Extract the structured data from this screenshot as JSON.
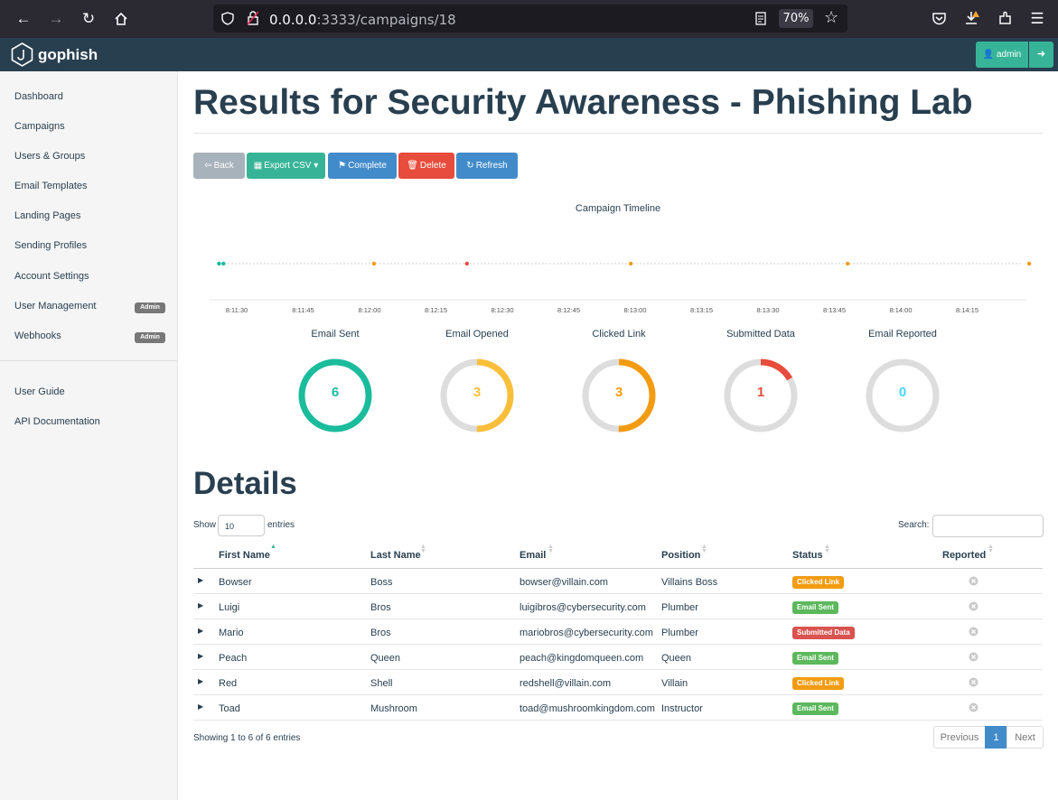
{
  "browser": {
    "url_host": "0.0.0.0",
    "url_rest": ":3333/campaigns/18",
    "zoom": "70%"
  },
  "navbar": {
    "brand": "gophish",
    "user_label": "admin"
  },
  "sidebar": {
    "items": [
      {
        "label": "Dashboard"
      },
      {
        "label": "Campaigns"
      },
      {
        "label": "Users & Groups"
      },
      {
        "label": "Email Templates"
      },
      {
        "label": "Landing Pages"
      },
      {
        "label": "Sending Profiles"
      },
      {
        "label": "Account Settings"
      },
      {
        "label": "User Management",
        "badge": "Admin"
      },
      {
        "label": "Webhooks",
        "badge": "Admin"
      }
    ],
    "secondary_items": [
      {
        "label": "User Guide"
      },
      {
        "label": "API Documentation"
      }
    ]
  },
  "page": {
    "title": "Results for Security Awareness - Phishing Lab",
    "buttons": {
      "back": "Back",
      "export": "Export CSV",
      "complete": "Complete",
      "delete": "Delete",
      "refresh": "Refresh"
    }
  },
  "timeline": {
    "title": "Campaign Timeline",
    "ticks": [
      "8:11:30",
      "8:11:45",
      "8:12:00",
      "8:12:15",
      "8:12:30",
      "8:12:45",
      "8:13:00",
      "8:13:15",
      "8:13:30",
      "8:13:45",
      "8:14:00",
      "8:14:15"
    ],
    "events": [
      {
        "time": "8:11:26",
        "type": "Email Sent",
        "color": "#1abc9c"
      },
      {
        "time": "8:11:27",
        "type": "Email Sent",
        "color": "#1abc9c"
      },
      {
        "time": "8:12:01",
        "type": "Email Opened",
        "color": "#f39c12"
      },
      {
        "time": "8:12:22",
        "type": "Submitted Data",
        "color": "#e74c3c"
      },
      {
        "time": "8:12:59",
        "type": "Email Opened",
        "color": "#f39c12"
      },
      {
        "time": "8:13:48",
        "type": "Clicked Link",
        "color": "#f39c12"
      },
      {
        "time": "8:14:29",
        "type": "Clicked Link",
        "color": "#f39c12"
      }
    ]
  },
  "stats": [
    {
      "label": "Email Sent",
      "value": "6",
      "total": 6,
      "count": 6,
      "color": "#1abc9c"
    },
    {
      "label": "Email Opened",
      "value": "3",
      "total": 6,
      "count": 3,
      "color": "#f9bf3b"
    },
    {
      "label": "Clicked Link",
      "value": "3",
      "total": 6,
      "count": 3,
      "color": "#f39c12"
    },
    {
      "label": "Submitted Data",
      "value": "1",
      "total": 6,
      "count": 1,
      "color": "#e74c3c"
    },
    {
      "label": "Email Reported",
      "value": "0",
      "total": 6,
      "count": 0,
      "color": "#45d6ef"
    }
  ],
  "details": {
    "title": "Details",
    "show_label": "Show",
    "page_length": "10",
    "entries_label": "entries",
    "search_label": "Search:",
    "columns": [
      "First Name",
      "Last Name",
      "Email",
      "Position",
      "Status",
      "Reported"
    ],
    "rows": [
      {
        "first": "Bowser",
        "last": "Boss",
        "email": "bowser@villain.com",
        "position": "Villains Boss",
        "status": "Clicked Link",
        "status_color": "#f39c12"
      },
      {
        "first": "Luigi",
        "last": "Bros",
        "email": "luigibros@cybersecurity.com",
        "position": "Plumber",
        "status": "Email Sent",
        "status_color": "#5cb85c"
      },
      {
        "first": "Mario",
        "last": "Bros",
        "email": "mariobros@cybersecurity.com",
        "position": "Plumber",
        "status": "Submitted Data",
        "status_color": "#d9534f"
      },
      {
        "first": "Peach",
        "last": "Queen",
        "email": "peach@kingdomqueen.com",
        "position": "Queen",
        "status": "Email Sent",
        "status_color": "#5cb85c"
      },
      {
        "first": "Red",
        "last": "Shell",
        "email": "redshell@villain.com",
        "position": "Villain",
        "status": "Clicked Link",
        "status_color": "#f39c12"
      },
      {
        "first": "Toad",
        "last": "Mushroom",
        "email": "toad@mushroomkingdom.com",
        "position": "Instructor",
        "status": "Email Sent",
        "status_color": "#5cb85c"
      }
    ],
    "info": "Showing 1 to 6 of 6 entries",
    "pager": {
      "previous": "Previous",
      "current": "1",
      "next": "Next"
    }
  }
}
